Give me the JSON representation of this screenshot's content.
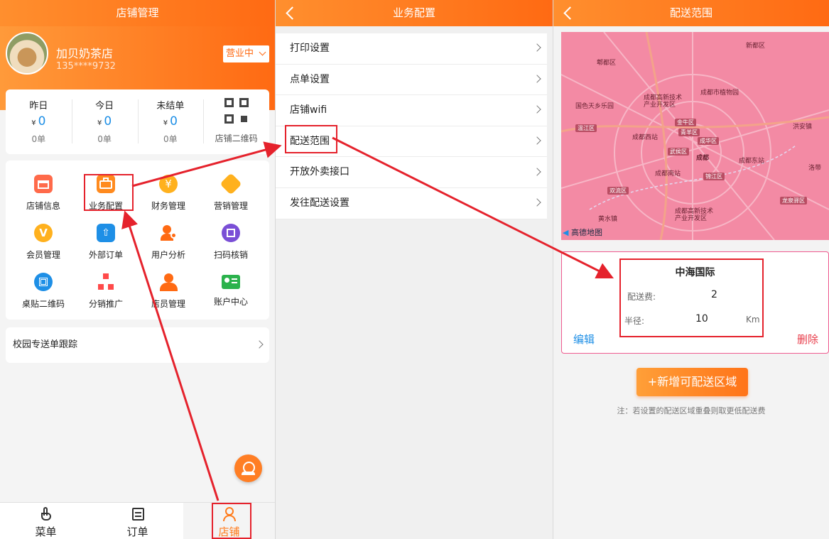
{
  "panel1": {
    "title": "店铺管理",
    "shop_name": "加贝奶茶店",
    "phone": "135****9732",
    "status": "营业中",
    "stats": [
      {
        "title": "昨日",
        "currency": "¥",
        "value": "0",
        "count": "0单"
      },
      {
        "title": "今日",
        "currency": "¥",
        "value": "0",
        "count": "0单"
      },
      {
        "title": "未结单",
        "currency": "¥",
        "value": "0",
        "count": "0单"
      }
    ],
    "qr_label": "店铺二维码",
    "grid": [
      {
        "label": "店铺信息",
        "icon": "shop-icon",
        "color": "#ff6a4a"
      },
      {
        "label": "业务配置",
        "icon": "briefcase-icon",
        "color": "#ff8a1e"
      },
      {
        "label": "财务管理",
        "icon": "yuan-coin-icon",
        "color": "#ffb11e"
      },
      {
        "label": "营销管理",
        "icon": "tag-icon",
        "color": "#ffb11e"
      },
      {
        "label": "会员管理",
        "icon": "vip-badge-icon",
        "color": "#ffb11e"
      },
      {
        "label": "外部订单",
        "icon": "upload-document-icon",
        "color": "#1e8fe6"
      },
      {
        "label": "用户分析",
        "icon": "user-chart-icon",
        "color": "#ff6a13"
      },
      {
        "label": "扫码核销",
        "icon": "scan-icon",
        "color": "#7a4fd6"
      },
      {
        "label": "桌贴二维码",
        "icon": "qr-code-icon",
        "color": "#1e8fe6"
      },
      {
        "label": "分销推广",
        "icon": "distribution-icon",
        "color": "#ff4a4a"
      },
      {
        "label": "店员管理",
        "icon": "staff-icon",
        "color": "#ff6a13"
      },
      {
        "label": "账户中心",
        "icon": "id-card-icon",
        "color": "#2bb24c"
      }
    ],
    "campus": "校园专送单跟踪",
    "tabs": [
      {
        "label": "菜单",
        "icon": "tap-hand-icon"
      },
      {
        "label": "订单",
        "icon": "order-list-icon"
      },
      {
        "label": "店铺",
        "icon": "user-icon"
      }
    ]
  },
  "panel2": {
    "title": "业务配置",
    "items": [
      "打印设置",
      "点单设置",
      "店铺wifi",
      "配送范围",
      "开放外卖接口",
      "发往配送设置"
    ]
  },
  "panel3": {
    "title": "配送范围",
    "map_labels": [
      "郫都区",
      "新都区",
      "成都市植物园",
      "国色天乡乐园",
      "成都高新技术产业开发区",
      "温江区",
      "成都西站",
      "金牛区",
      "青羊区",
      "成华区",
      "武侯区",
      "成都东站",
      "成都南站",
      "锦江区",
      "双流区",
      "龙泉驿区",
      "洪安镇",
      "洛带",
      "黄水镇",
      "成都高新技术产业开发区",
      "成都",
      "高德地图"
    ],
    "zone": {
      "name": "中海国际",
      "fee_label": "配送费:",
      "fee": "2",
      "radius_label": "半径:",
      "radius": "10",
      "unit": "Km",
      "edit": "编辑",
      "delete": "删除"
    },
    "add_button": "+新增可配送区域",
    "note": "注：若设置的配送区域重叠则取更低配送费"
  },
  "colors": {
    "accent": "#ff7a1a",
    "link": "#1e8fe6",
    "annotation": "#e5222c",
    "delivery_zone": "#f38aa4"
  }
}
